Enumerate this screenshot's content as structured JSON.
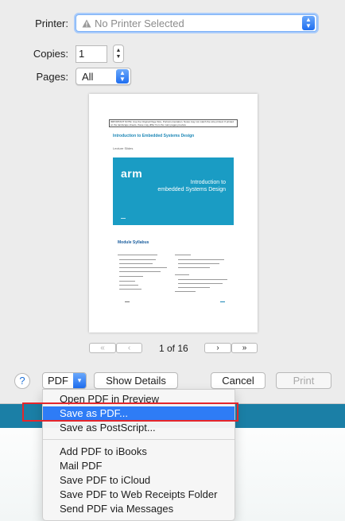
{
  "printer": {
    "label": "Printer:",
    "value": "No Printer Selected",
    "icon": "warning-icon"
  },
  "copies": {
    "label": "Copies:",
    "value": "1"
  },
  "pages": {
    "label": "Pages:",
    "value": "All"
  },
  "preview": {
    "notice": "IMPORTANT NOTE: Use the Original Page Size, Portrait orientation. Notes may not match the size printed. If printed on the landscape sheets, these may differ from the main pages preview.",
    "title": "Introduction to Embedded Systems Design",
    "subtitle": "Lecture Slides",
    "banner_logo": "arm",
    "banner_title_line1": "Introduction to",
    "banner_title_line2": "embedded Systems Design",
    "section": "Module Syllabus"
  },
  "pagination": {
    "first_label": "«",
    "prev_label": "‹",
    "page_text": "1 of 16",
    "next_label": "›",
    "last_label": "»"
  },
  "footer": {
    "help_label": "?",
    "pdf_label": "PDF",
    "show_details_label": "Show Details",
    "cancel_label": "Cancel",
    "print_label": "Print"
  },
  "menu": {
    "items": [
      "Open PDF in Preview",
      "Save as PDF...",
      "Save as PostScript...",
      "Add PDF to iBooks",
      "Mail PDF",
      "Save PDF to iCloud",
      "Save PDF to Web Receipts Folder",
      "Send PDF via Messages"
    ],
    "active_index": 1
  },
  "colors": {
    "accent": "#2e7cf6",
    "highlight": "#e5262b",
    "banner": "#1a9cc4"
  }
}
